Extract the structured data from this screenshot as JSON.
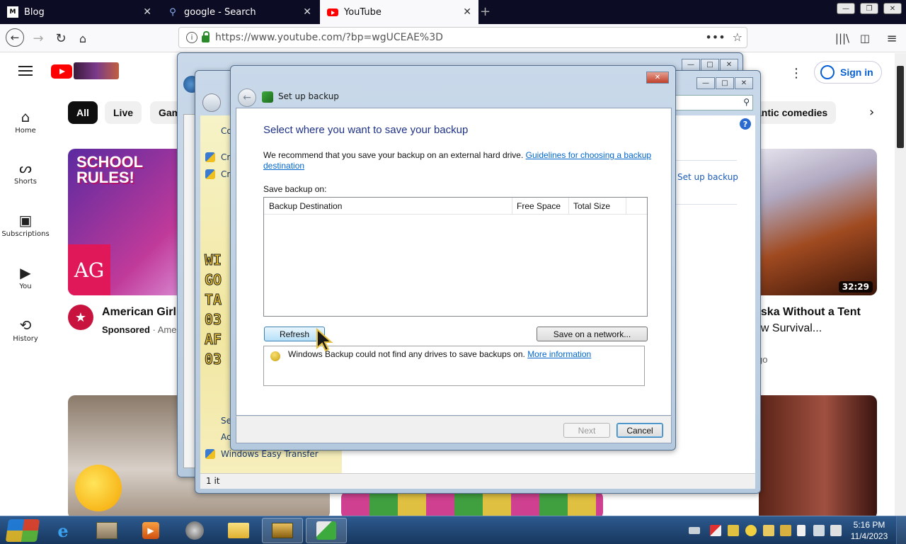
{
  "browser": {
    "tabs": [
      {
        "title": "Blog"
      },
      {
        "title": "google - Search"
      },
      {
        "title": "YouTube"
      }
    ],
    "url": "https://www.youtube.com/?bp=wgUCEAE%3D"
  },
  "youtube": {
    "signin": "Sign in",
    "sidebar": [
      {
        "label": "Home"
      },
      {
        "label": "Shorts"
      },
      {
        "label": "Subscriptions"
      },
      {
        "label": "You"
      },
      {
        "label": "History"
      }
    ],
    "chips": [
      "All",
      "Live",
      "Gam",
      "antic comedies"
    ],
    "videos": [
      {
        "title": "American Girl I",
        "meta1": "Sponsored",
        "meta2": "· Amer",
        "thumb_text": "SCHOOL RULES!"
      },
      {
        "title_line1": "aska Without a Tent",
        "title_line2": "ow Survival...",
        "meta": "go",
        "duration": "32:29"
      }
    ]
  },
  "behind_window": {
    "items": [
      "Co",
      "Cr",
      "Cr",
      "Se",
      "Ac",
      "Windows Easy Transfer"
    ],
    "link": "Set up backup",
    "status": "1 it",
    "poster_text": [
      "WI",
      "GO",
      "TA",
      "03",
      "AF",
      "03"
    ]
  },
  "dialog": {
    "title": "Set up backup",
    "heading": "Select where you want to save your backup",
    "recommend_text": "We recommend that you save your backup on an external hard drive. ",
    "guidelines_link_1": "Guidelines for choosing a backup",
    "guidelines_link_2": "destination",
    "save_label": "Save backup on:",
    "columns": [
      "Backup Destination",
      "Free Space",
      "Total Size"
    ],
    "refresh_button": "Refresh",
    "network_button": "Save on a network...",
    "message": "Windows Backup could not find any drives to save backups on. ",
    "more_info_link": "More information",
    "next_button": "Next",
    "cancel_button": "Cancel"
  },
  "taskbar": {
    "time": "5:16 PM",
    "date": "11/4/2023"
  }
}
